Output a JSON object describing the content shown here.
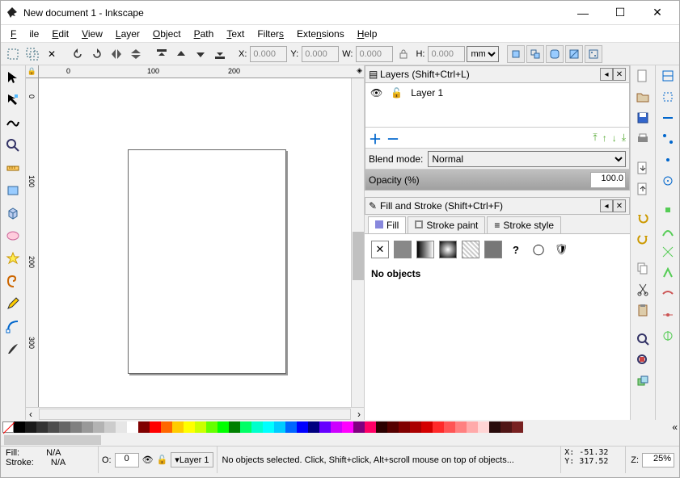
{
  "window": {
    "title": "New document 1 - Inkscape",
    "minimize": "—",
    "maximize": "☐",
    "close": "✕"
  },
  "menu": {
    "file": "File",
    "edit": "Edit",
    "view": "View",
    "layer": "Layer",
    "object": "Object",
    "path": "Path",
    "text": "Text",
    "filters": "Filters",
    "extensions": "Extensions",
    "help": "Help"
  },
  "tooloptions": {
    "x_label": "X:",
    "x_val": "0.000",
    "y_label": "Y:",
    "y_val": "0.000",
    "w_label": "W:",
    "w_val": "0.000",
    "h_label": "H:",
    "h_val": "0.000",
    "unit": "mm"
  },
  "ruler_h": {
    "t0": "0",
    "t1": "100",
    "t2": "200"
  },
  "ruler_v": {
    "t0": "0",
    "t1": "100",
    "t2": "200",
    "t3": "300"
  },
  "layers_panel": {
    "title": "Layers (Shift+Ctrl+L)",
    "layer1": "Layer 1",
    "blend_label": "Blend mode:",
    "blend_value": "Normal",
    "opacity_label": "Opacity (%)",
    "opacity_value": "100.0"
  },
  "fillstroke_panel": {
    "title": "Fill and Stroke (Shift+Ctrl+F)",
    "tab_fill": "Fill",
    "tab_strokepaint": "Stroke paint",
    "tab_strokestyle": "Stroke style",
    "no_objects": "No objects",
    "qmark": "?"
  },
  "palette_colors": [
    "#000000",
    "#1a1a1a",
    "#333333",
    "#4d4d4d",
    "#666666",
    "#808080",
    "#999999",
    "#b3b3b3",
    "#cccccc",
    "#e6e6e6",
    "#ffffff",
    "#800000",
    "#ff0000",
    "#ff6600",
    "#ffcc00",
    "#ffff00",
    "#ccff00",
    "#66ff00",
    "#00ff00",
    "#008000",
    "#00ff66",
    "#00ffcc",
    "#00ffff",
    "#00ccff",
    "#0066ff",
    "#0000ff",
    "#000080",
    "#6600ff",
    "#cc00ff",
    "#ff00ff",
    "#800080",
    "#ff0066",
    "#2b0000",
    "#550000",
    "#800000",
    "#aa0000",
    "#d40000",
    "#ff2a2a",
    "#ff5555",
    "#ff8080",
    "#ffaaaa",
    "#ffd5d5",
    "#280b0b",
    "#501616",
    "#782121"
  ],
  "statusbar": {
    "fill_label": "Fill:",
    "fill_value": "N/A",
    "stroke_label": "Stroke:",
    "stroke_value": "N/A",
    "o_label": "O:",
    "o_value": "0",
    "layer_label": "Layer 1",
    "message": "No objects selected. Click, Shift+click, Alt+scroll mouse on top of objects...",
    "x": "-51.32",
    "y": "317.52",
    "x_lbl": "X:",
    "y_lbl": "Y:",
    "z_label": "Z:",
    "z_value": "25%"
  }
}
